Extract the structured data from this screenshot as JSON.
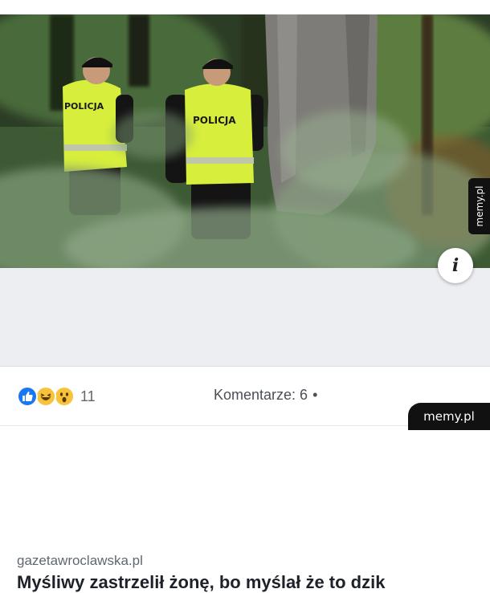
{
  "photo": {
    "vest_text_left": "POLICJA",
    "vest_text_right": "POLICJA"
  },
  "info_button": {
    "label": "i"
  },
  "watermark_side": "memy.pl",
  "link_preview": {
    "domain": "gazetawroclawska.pl",
    "title": "Myśliwy zastrzelił żonę, bo myślał że to dzik"
  },
  "reactions": {
    "icons": [
      "like-icon",
      "haha-icon",
      "wow-icon"
    ],
    "count": "11"
  },
  "comments": {
    "label": "Komentarze: 6",
    "bullet": "•"
  },
  "watermark_bottom": "memy.pl",
  "colors": {
    "like": "#1877f2",
    "emoji": "#f7c33b",
    "vest": "#d7ee3c",
    "caption_bg": "#eceef1"
  }
}
